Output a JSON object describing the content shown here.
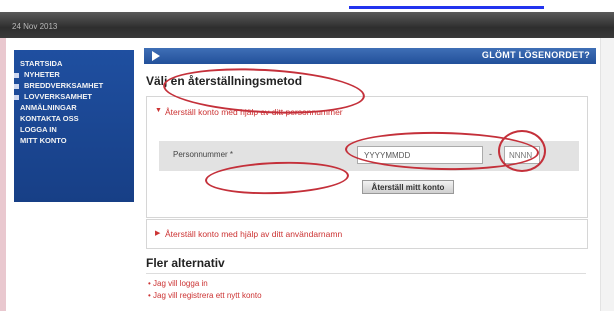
{
  "banner": {
    "date": "24 Nov 2013"
  },
  "nav": {
    "items": [
      {
        "label": "STARTSIDA",
        "marker": false
      },
      {
        "label": "NYHETER",
        "marker": true
      },
      {
        "label": "BREDDVERKSAMHET",
        "marker": true
      },
      {
        "label": "LOVVERKSAMHET",
        "marker": true
      },
      {
        "label": "ANMÄLNINGAR",
        "marker": false
      },
      {
        "label": "KONTAKTA OSS",
        "marker": false
      },
      {
        "label": "LOGGA IN",
        "marker": false
      },
      {
        "label": "MITT KONTO",
        "marker": false
      }
    ]
  },
  "panel": {
    "title": "GLÖMT LÖSENORDET?",
    "heading": "Välj en återställningsmetod",
    "section1": {
      "title": "Återställ konto med hjälp av ditt personnummer",
      "field_label": "Personnummer *",
      "date_placeholder": "YYYYMMDD",
      "separator": "-",
      "suffix_placeholder": "NNNN",
      "button": "Återställ mitt konto"
    },
    "section2": {
      "title": "Återställ konto med hjälp av ditt användarnamn"
    },
    "more_heading": "Fler alternativ",
    "links": [
      "Jag vill logga in",
      "Jag vill registrera ett nytt konto"
    ]
  },
  "colors": {
    "nav_bg": "#1f4fa0",
    "accent_red": "#c33",
    "annotation": "#c4303a"
  }
}
